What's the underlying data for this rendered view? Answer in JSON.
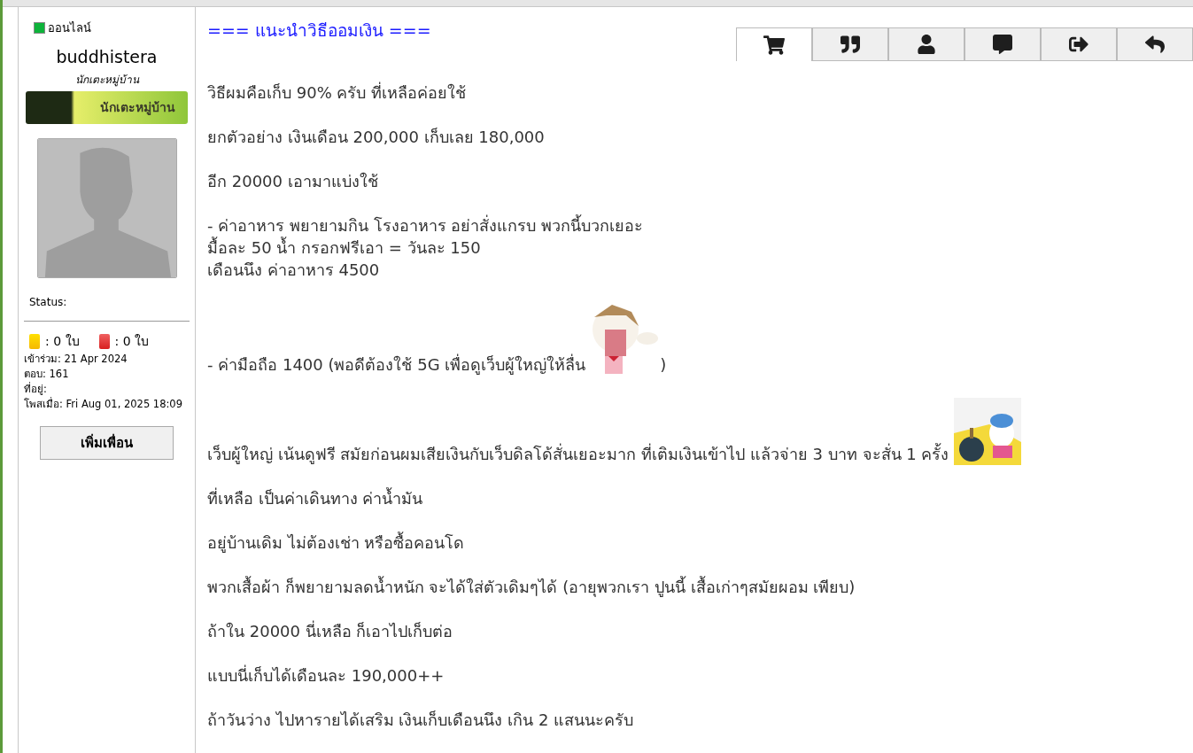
{
  "profile": {
    "online": true,
    "online_label": "ออนไลน์",
    "username": "buddhistera",
    "rank_title": "นักเตะหมู่บ้าน",
    "rank_banner": "นักเตะหมู่บ้าน",
    "status_label": "Status:",
    "yellow_cards": ": 0 ใบ",
    "red_cards": ": 0 ใบ",
    "info": [
      "เข้าร่วม: 21 Apr 2024",
      "ตอบ: 161",
      "ที่อยู่:",
      "โพสเมื่อ: Fri Aug 01, 2025 18:09"
    ],
    "add_friend": "เพิ่มเพื่อน"
  },
  "post": {
    "title": "=== แนะนำวิธีออมเงิน ===",
    "tabs": [
      {
        "kind": "cart",
        "selected": true
      },
      {
        "kind": "quote",
        "selected": false
      },
      {
        "kind": "profile",
        "selected": false
      },
      {
        "kind": "message",
        "selected": false
      },
      {
        "kind": "exit",
        "selected": false
      },
      {
        "kind": "reply",
        "selected": false
      }
    ],
    "paragraphs": [
      {
        "segments": [
          {
            "kind": "text",
            "text": "วิธีผมคือเก็บ 90% ครับ ที่เหลือค่อยใช้"
          }
        ]
      },
      {
        "segments": [
          {
            "kind": "text",
            "text": "ยกตัวอย่าง เงินเดือน 200,000 เก็บเลย 180,000"
          }
        ]
      },
      {
        "segments": [
          {
            "kind": "text",
            "text": "อีก 20000 เอามาแบ่งใช้"
          }
        ]
      },
      {
        "segments": [
          {
            "kind": "text",
            "text": "- ค่าอาหาร พยายามกิน โรงอาหาร อย่าสั่งแกรบ พวกนี้บวกเยอะ"
          },
          {
            "kind": "break"
          },
          {
            "kind": "text",
            "text": "มื้อละ 50 น้ำ กรอกฟรีเอา = วันละ 150"
          },
          {
            "kind": "break"
          },
          {
            "kind": "text",
            "text": "เดือนนึง ค่าอาหาร 4500"
          }
        ]
      },
      {
        "segments": [
          {
            "kind": "text",
            "text": "- ค่ามือถือ 1400 (พอดีต้องใช้ 5G เพื่อดูเว็บผู้ใหญ่ให้ลื่น"
          },
          {
            "kind": "picture"
          },
          {
            "kind": "text",
            "text": ")"
          }
        ]
      },
      {
        "segments": [
          {
            "kind": "text",
            "text": "เว็บผู้ใหญ่ เน้นดูฟรี สมัยก่อนผมเสียเงินกับเว็บดิลโด้สั่นเยอะมาก ที่เติมเงินเข้าไป แล้วจ่าย 3 บาท จะสั่น 1 ครั้ง"
          },
          {
            "kind": "picture"
          }
        ]
      },
      {
        "segments": [
          {
            "kind": "text",
            "text": "ที่เหลือ เป็นค่าเดินทาง ค่าน้ำมัน"
          }
        ]
      },
      {
        "segments": [
          {
            "kind": "text",
            "text": "อยู่บ้านเดิม ไม่ต้องเช่า หรือซื้อคอนโด"
          }
        ]
      },
      {
        "segments": [
          {
            "kind": "text",
            "text": "พวกเสื้อผ้า ก็พยายามลดน้ำหนัก จะได้ใส่ตัวเดิมๆได้ (อายุพวกเรา ปูนนี้ เสื้อเก่าๆสมัยผอม เพียบ)"
          }
        ]
      },
      {
        "segments": [
          {
            "kind": "text",
            "text": "ถ้าใน 20000 นี่เหลือ ก็เอาไปเก็บต่อ"
          }
        ]
      },
      {
        "segments": [
          {
            "kind": "text",
            "text": "แบบนี่เก็บได้เดือนละ 190,000++"
          }
        ]
      },
      {
        "segments": [
          {
            "kind": "text",
            "text": "ถ้าวันว่าง ไปหารายได้เสริม เงินเก็บเดือนนึง เกิน 2 แสนนะครับ"
          }
        ]
      }
    ]
  }
}
